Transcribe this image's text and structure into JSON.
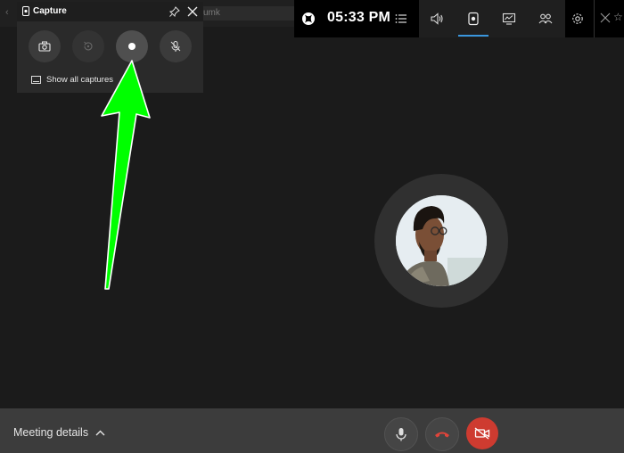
{
  "capture_widget": {
    "title": "Capture",
    "show_all_label": "Show all captures",
    "buttons": [
      {
        "name": "screenshot",
        "icon": "camera-icon"
      },
      {
        "name": "record-last-30s",
        "icon": "record-last-icon"
      },
      {
        "name": "start-recording",
        "icon": "record-dot-icon"
      },
      {
        "name": "mic-toggle",
        "icon": "mic-off-icon"
      }
    ]
  },
  "game_bar": {
    "time": "05:33 PM",
    "accent": "#3a96dd"
  },
  "browser": {
    "tab_fragment": "umk"
  },
  "meeting": {
    "details_label": "Meeting details",
    "end_call_color": "#ce3b30"
  },
  "annotation": {
    "arrow_color": "#00ff00"
  }
}
